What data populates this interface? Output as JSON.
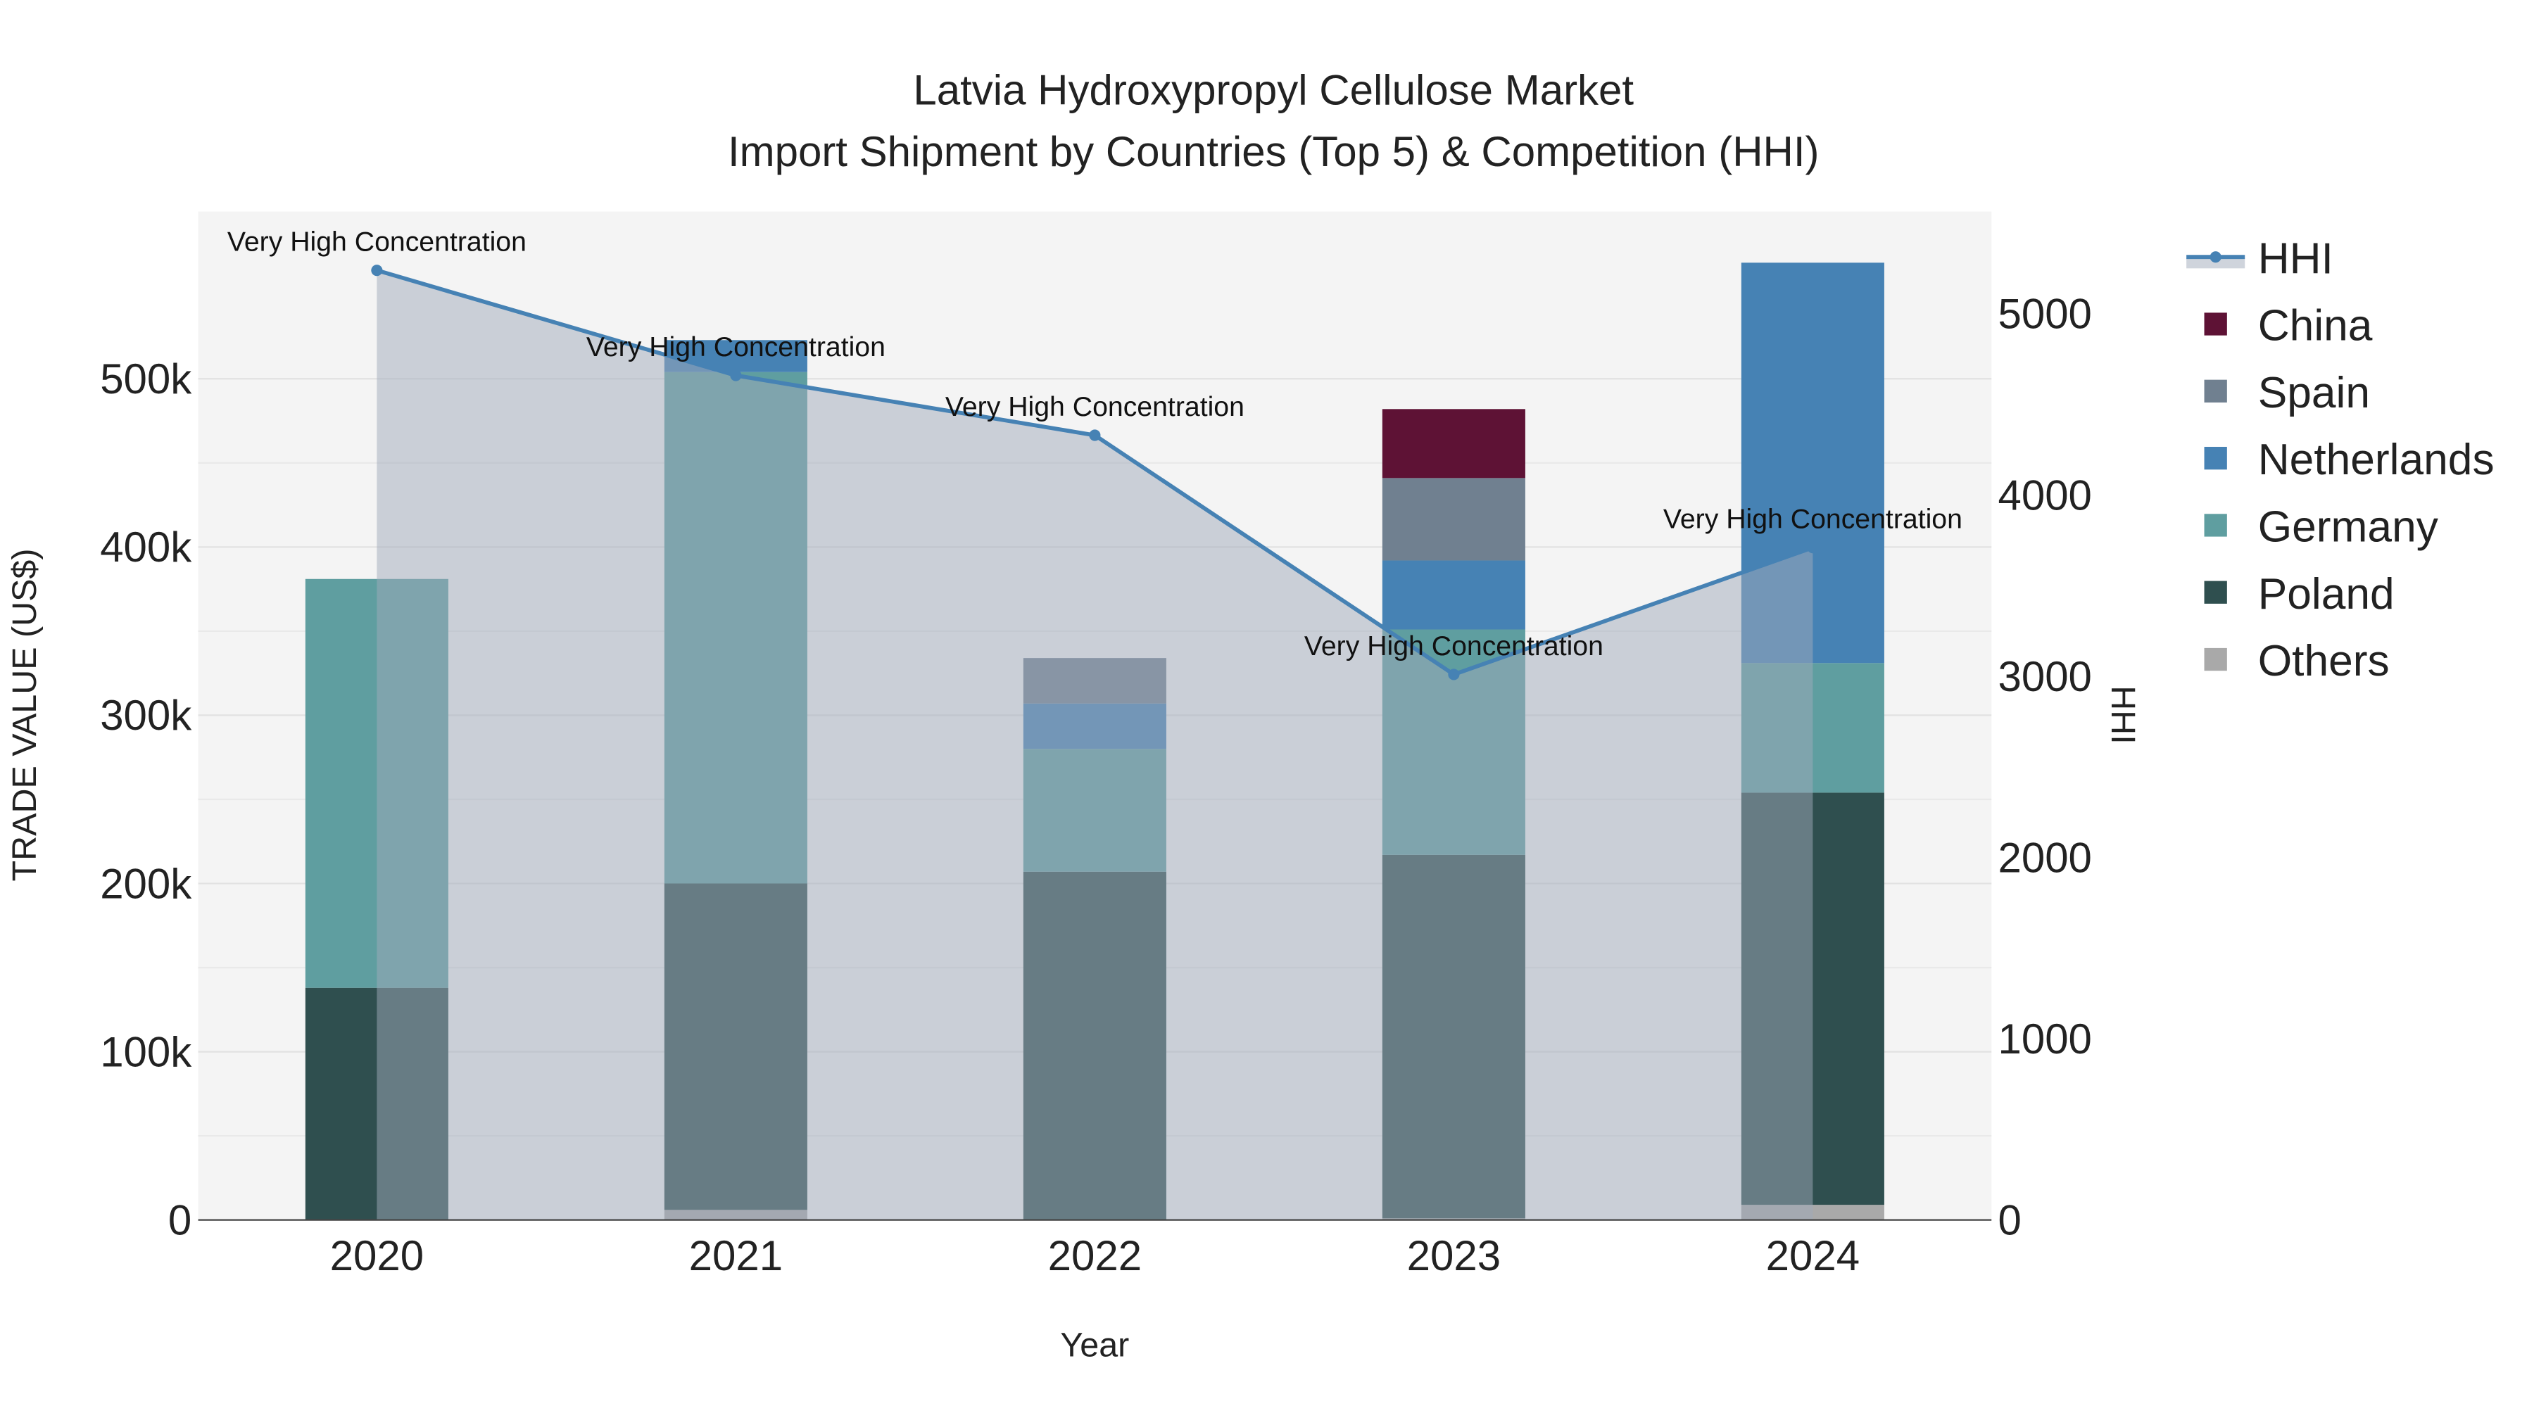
{
  "chart_data": {
    "type": "bar",
    "title": "Latvia Hydroxypropyl Cellulose Market",
    "subtitle": "Import Shipment by Countries (Top 5) & Competition (HHI)",
    "xlabel": "Year",
    "ylabel": "TRADE VALUE (US$)",
    "y2label": "HHI",
    "ylim": [
      0,
      600000
    ],
    "y2lim": [
      0,
      5560
    ],
    "yticks": [
      0,
      100000,
      200000,
      300000,
      400000,
      500000
    ],
    "ytick_labels": [
      "0",
      "100k",
      "200k",
      "300k",
      "400k",
      "500k"
    ],
    "y2ticks": [
      0,
      1000,
      2000,
      3000,
      4000,
      5000
    ],
    "y2tick_labels": [
      "0",
      "1000",
      "2000",
      "3000",
      "4000",
      "5000"
    ],
    "categories": [
      "2020",
      "2021",
      "2022",
      "2023",
      "2024"
    ],
    "stacked": true,
    "series": [
      {
        "name": "Others",
        "color": "#a9a9a9",
        "values": [
          0,
          6000,
          0,
          1000,
          9000
        ]
      },
      {
        "name": "Poland",
        "color": "#2f4f4f",
        "values": [
          138000,
          194000,
          207000,
          216000,
          245000
        ]
      },
      {
        "name": "Germany",
        "color": "#5f9ea0",
        "values": [
          243000,
          304000,
          73000,
          134000,
          77000
        ]
      },
      {
        "name": "Netherlands",
        "color": "#4682b4",
        "values": [
          0,
          19000,
          27000,
          41000,
          238000
        ]
      },
      {
        "name": "Spain",
        "color": "#708090",
        "values": [
          0,
          0,
          27000,
          49000,
          0
        ]
      },
      {
        "name": "China",
        "color": "#5e1235",
        "values": [
          0,
          0,
          0,
          41000,
          0
        ]
      }
    ],
    "line": {
      "name": "HHI",
      "color": "#4682b4",
      "values": [
        5240,
        4660,
        4330,
        3010,
        3710
      ]
    },
    "annotations": [
      "Very High Concentration",
      "Very High Concentration",
      "Very High Concentration",
      "Very High Concentration",
      "Very High Concentration"
    ],
    "legend_order": [
      "HHI",
      "China",
      "Spain",
      "Netherlands",
      "Germany",
      "Poland",
      "Others"
    ],
    "legend_position": "right",
    "grid": true
  }
}
